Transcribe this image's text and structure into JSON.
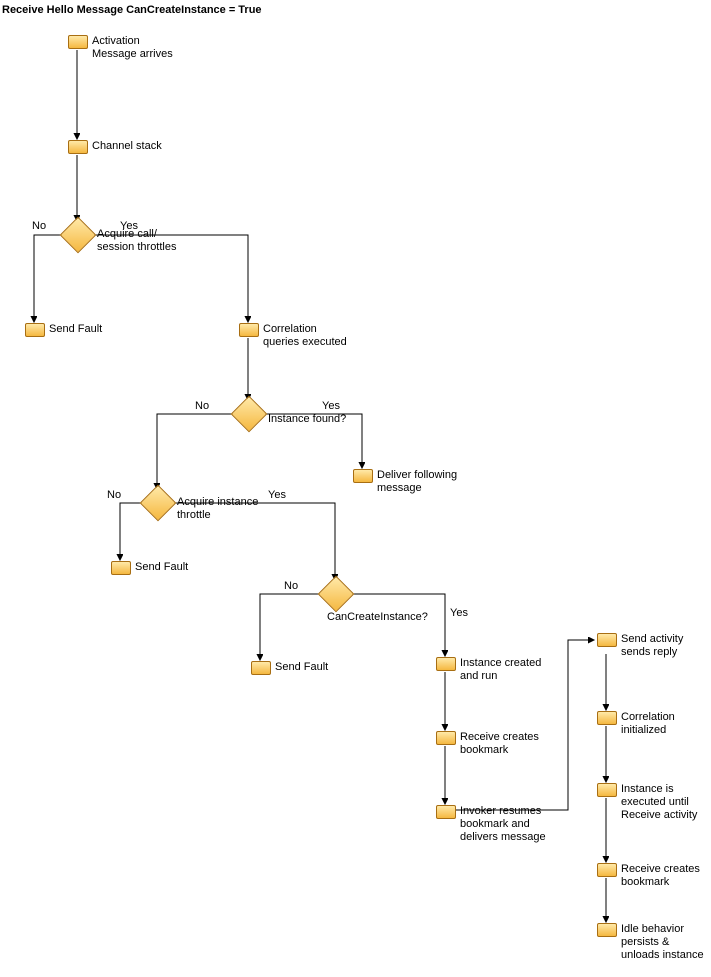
{
  "title": "Receive Hello Message CanCreateInstance = True",
  "nodes": {
    "activation": "Activation\nMessage arrives",
    "channel": "Channel stack",
    "acquire_throttles": "Acquire call/\nsession throttles",
    "send_fault_1": "Send Fault",
    "correlation_exec": "Correlation\nqueries executed",
    "instance_found": "Instance found?",
    "deliver_following": "Deliver following\nmessage",
    "acquire_instance": "Acquire instance\nthrottle",
    "send_fault_2": "Send Fault",
    "can_create": "CanCreateInstance?",
    "send_fault_3": "Send Fault",
    "instance_created": "Instance created\nand run",
    "receive_bookmark": "Receive creates\nbookmark",
    "invoker": "Invoker resumes\nbookmark and\ndelivers message",
    "send_reply": "Send activity\nsends reply",
    "correlation_init": "Correlation\ninitialized",
    "instance_exec": "Instance is\nexecuted until\nReceive activity",
    "receive_bookmark2": "Receive creates\nbookmark",
    "idle": "Idle behavior\npersists &\nunloads instance"
  },
  "edges": {
    "yes": "Yes",
    "no": "No"
  }
}
